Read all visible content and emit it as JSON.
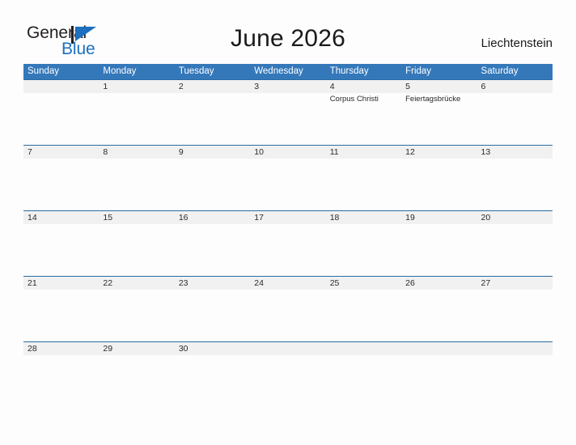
{
  "brand": {
    "name_part1": "General",
    "name_part2": "Blue",
    "flag_icon": "blue-flag-triangle-icon",
    "accent_color": "#1d6fc0"
  },
  "header": {
    "title": "June 2026",
    "country": "Liechtenstein"
  },
  "theme": {
    "header_blue": "#3478ba",
    "band_gray": "#f1f1f1",
    "band_border": "#2b6ca3",
    "page_background": "#fdfdfd",
    "text_color": "#2a2a2a"
  },
  "calendar": {
    "weekdays": [
      "Sunday",
      "Monday",
      "Tuesday",
      "Wednesday",
      "Thursday",
      "Friday",
      "Saturday"
    ],
    "weeks": [
      {
        "days": [
          {
            "number": "",
            "events": []
          },
          {
            "number": "1",
            "events": []
          },
          {
            "number": "2",
            "events": []
          },
          {
            "number": "3",
            "events": []
          },
          {
            "number": "4",
            "events": [
              "Corpus Christi"
            ]
          },
          {
            "number": "5",
            "events": [
              "Feiertagsbrücke"
            ]
          },
          {
            "number": "6",
            "events": []
          }
        ]
      },
      {
        "days": [
          {
            "number": "7",
            "events": []
          },
          {
            "number": "8",
            "events": []
          },
          {
            "number": "9",
            "events": []
          },
          {
            "number": "10",
            "events": []
          },
          {
            "number": "11",
            "events": []
          },
          {
            "number": "12",
            "events": []
          },
          {
            "number": "13",
            "events": []
          }
        ]
      },
      {
        "days": [
          {
            "number": "14",
            "events": []
          },
          {
            "number": "15",
            "events": []
          },
          {
            "number": "16",
            "events": []
          },
          {
            "number": "17",
            "events": []
          },
          {
            "number": "18",
            "events": []
          },
          {
            "number": "19",
            "events": []
          },
          {
            "number": "20",
            "events": []
          }
        ]
      },
      {
        "days": [
          {
            "number": "21",
            "events": []
          },
          {
            "number": "22",
            "events": []
          },
          {
            "number": "23",
            "events": []
          },
          {
            "number": "24",
            "events": []
          },
          {
            "number": "25",
            "events": []
          },
          {
            "number": "26",
            "events": []
          },
          {
            "number": "27",
            "events": []
          }
        ]
      },
      {
        "days": [
          {
            "number": "28",
            "events": []
          },
          {
            "number": "29",
            "events": []
          },
          {
            "number": "30",
            "events": []
          },
          {
            "number": "",
            "events": []
          },
          {
            "number": "",
            "events": []
          },
          {
            "number": "",
            "events": []
          },
          {
            "number": "",
            "events": []
          }
        ]
      }
    ]
  }
}
